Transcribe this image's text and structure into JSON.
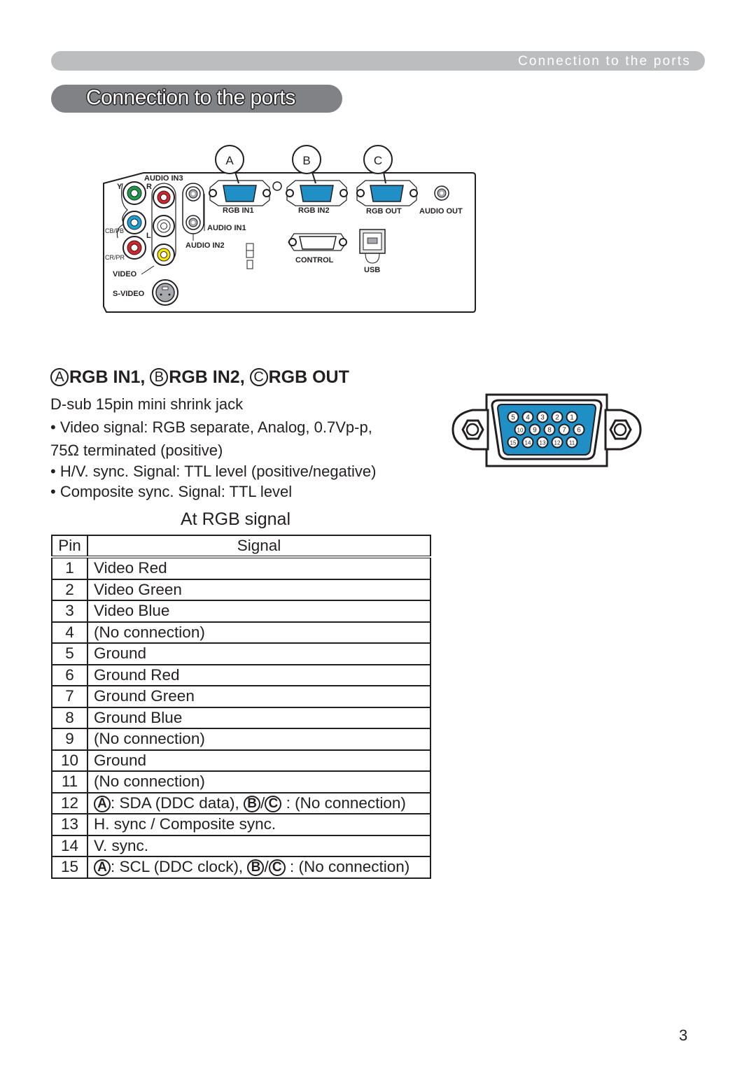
{
  "header": {
    "running_title": "Connection to the ports"
  },
  "title": {
    "text": "Connection to the ports"
  },
  "panel": {
    "callouts": [
      "A",
      "B",
      "C"
    ],
    "labels": {
      "audio_in3": "AUDIO IN3",
      "y": "Y",
      "r": "R",
      "l": "L",
      "cb_pb": "CB/PB",
      "cr_pr": "CR/PR",
      "video": "VIDEO",
      "s_video": "S-VIDEO",
      "audio_in1": "AUDIO IN1",
      "audio_in2": "AUDIO IN2",
      "rgb_in1": "RGB IN1",
      "rgb_in2": "RGB IN2",
      "rgb_out": "RGB OUT",
      "audio_out": "AUDIO OUT",
      "control": "CONTROL",
      "usb": "USB"
    },
    "jack_colors": {
      "green": "#1a9a4a",
      "blue": "#1ba0d8",
      "red": "#d6222b",
      "yellow": "#f6e500",
      "vga_blue": "#1f8fc6"
    }
  },
  "section": {
    "heading_parts": [
      {
        "badge": "A",
        "text": "RGB IN1, "
      },
      {
        "badge": "B",
        "text": "RGB IN2, "
      },
      {
        "badge": "C",
        "text": "RGB OUT"
      }
    ],
    "specs": [
      " D-sub 15pin mini shrink jack",
      "• Video signal: RGB separate, Analog, 0.7Vp-p,",
      "75Ω terminated (positive)",
      "• H/V. sync. Signal: TTL level (positive/negative)",
      "• Composite sync. Signal: TTL level"
    ]
  },
  "connector": {
    "pin_rows": [
      [
        "5",
        "4",
        "3",
        "2",
        "1"
      ],
      [
        "10",
        "9",
        "8",
        "7",
        "6"
      ],
      [
        "15",
        "14",
        "13",
        "12",
        "11"
      ]
    ]
  },
  "table": {
    "caption": "At RGB signal",
    "headers": {
      "pin": "Pin",
      "signal": "Signal"
    },
    "rows": [
      {
        "pin": "1",
        "signal": "Video Red"
      },
      {
        "pin": "2",
        "signal": "Video Green"
      },
      {
        "pin": "3",
        "signal": "Video Blue"
      },
      {
        "pin": "4",
        "signal": "(No connection)"
      },
      {
        "pin": "5",
        "signal": "Ground"
      },
      {
        "pin": "6",
        "signal": "Ground Red"
      },
      {
        "pin": "7",
        "signal": "Ground Green"
      },
      {
        "pin": "8",
        "signal": "Ground Blue"
      },
      {
        "pin": "9",
        "signal": "(No connection)"
      },
      {
        "pin": "10",
        "signal": "Ground"
      },
      {
        "pin": "11",
        "signal": "(No connection)"
      },
      {
        "pin": "12",
        "signal_parts": {
          "a_badge": "A",
          "a_text": ": SDA (DDC data), ",
          "b_badge": "B",
          "sep": "/",
          "c_badge": "C",
          "bc_text": " : (No connection)"
        }
      },
      {
        "pin": "13",
        "signal": "H. sync / Composite sync."
      },
      {
        "pin": "14",
        "signal": "V. sync."
      },
      {
        "pin": "15",
        "signal_parts": {
          "a_badge": "A",
          "a_text": ": SCL (DDC clock), ",
          "b_badge": "B",
          "sep": "/",
          "c_badge": "C",
          "bc_text": " : (No connection)"
        }
      }
    ]
  },
  "footer": {
    "page_number": "3"
  }
}
